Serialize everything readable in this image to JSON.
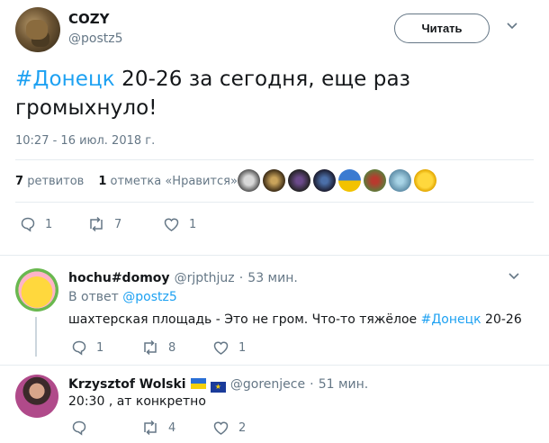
{
  "tweet": {
    "author_name": "COZY",
    "author_handle": "@postz5",
    "follow_label": "Читать",
    "text_hashtag": "#Донецк",
    "text_line1_rest": " 20-26 за сегодня, еще раз",
    "text_line2": "громыхнуло!",
    "timestamp": "10:27 - 16 июл. 2018 г.",
    "retweets_count": "7",
    "retweets_label": "ретвитов",
    "likes_count": "1",
    "likes_label": "отметка «Нравится»",
    "action_replies": "1",
    "action_retweets": "7",
    "action_likes": "1"
  },
  "replies": [
    {
      "name": "hochu#domoy",
      "handle": "@rjpthjuz",
      "time": "53 мин.",
      "reply_to_prefix": "В ответ",
      "reply_to_handle": "@postz5",
      "text_plain": "шахтерская площадь - Это не гром. Что-то тяжёлое ",
      "text_hashtag": "#Донецк",
      "text_after": " 20-26",
      "replies": "1",
      "retweets": "8",
      "likes": "1"
    },
    {
      "name": "Krzysztof Wolski",
      "handle": "@gorenjece",
      "time": "51 мин.",
      "text": "20:30 ‚ ат конкретно",
      "replies": "",
      "retweets": "4",
      "likes": "2"
    }
  ],
  "separator": "·",
  "colors": {
    "accent": "#1da1f2",
    "muted": "#657786",
    "border": "#e6ecf0"
  }
}
